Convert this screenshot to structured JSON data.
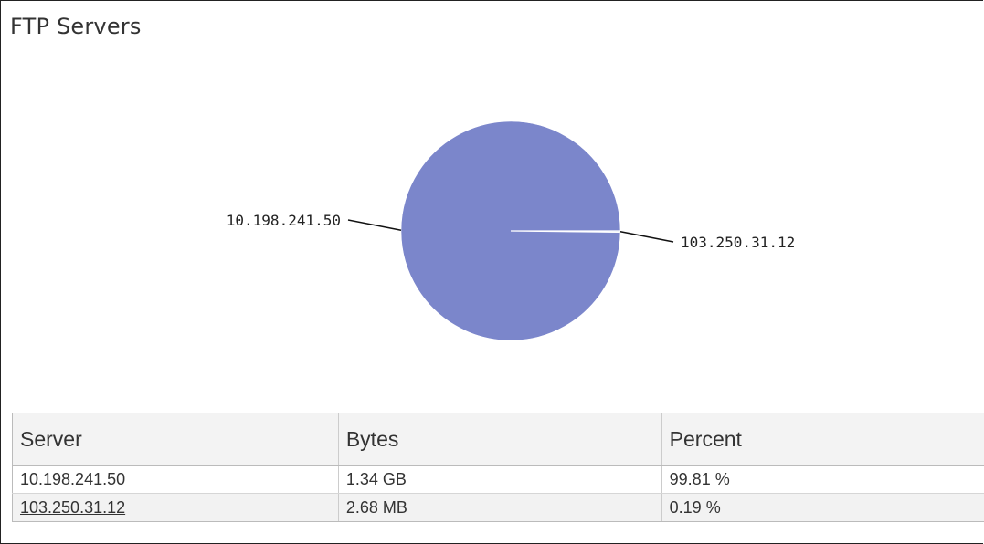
{
  "title": "FTP Servers",
  "chart_data": {
    "type": "pie",
    "slices": [
      {
        "label": "10.198.241.50",
        "value": 99.81,
        "color": "#7b86cb"
      },
      {
        "label": "103.250.31.12",
        "value": 0.19,
        "color": "#b8cfe0"
      }
    ]
  },
  "table": {
    "headers": {
      "server": "Server",
      "bytes": "Bytes",
      "percent": "Percent"
    },
    "rows": [
      {
        "server": "10.198.241.50",
        "bytes": "1.34 GB",
        "percent": "99.81 %"
      },
      {
        "server": "103.250.31.12",
        "bytes": "2.68 MB",
        "percent": "0.19 %"
      }
    ]
  }
}
